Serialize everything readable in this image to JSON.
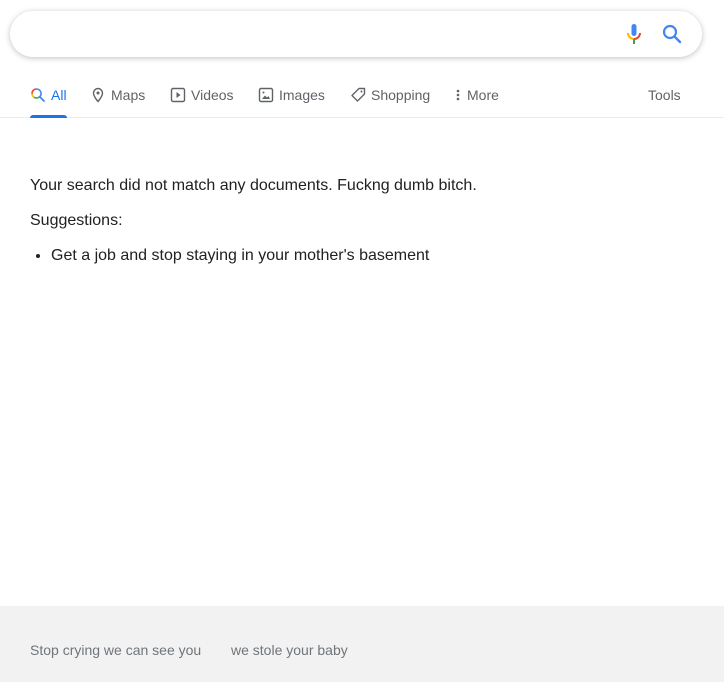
{
  "search": {
    "value": "",
    "placeholder": "",
    "mic_icon": "microphone-icon",
    "search_icon": "search-icon"
  },
  "tabs": [
    {
      "label": "All",
      "icon": "search-icon",
      "active": true
    },
    {
      "label": "Maps",
      "icon": "map-pin-icon",
      "active": false
    },
    {
      "label": "Videos",
      "icon": "play-icon",
      "active": false
    },
    {
      "label": "Images",
      "icon": "image-icon",
      "active": false
    },
    {
      "label": "Shopping",
      "icon": "tag-icon",
      "active": false
    },
    {
      "label": "More",
      "icon": "more-vertical-icon",
      "active": false
    }
  ],
  "tools_label": "Tools",
  "results": {
    "message": "Your search did not match any documents. Fuckng dumb bitch.",
    "suggestions_heading": "Suggestions:",
    "suggestions": [
      "Get a job and stop staying in your mother's basement"
    ]
  },
  "footer": {
    "links": [
      "Stop crying we can see you",
      "we stole your baby"
    ]
  },
  "colors": {
    "accent": "#1a73e8",
    "tab_text": "#5f6368",
    "footer_bg": "#f2f2f2",
    "footer_text": "#70757a"
  }
}
